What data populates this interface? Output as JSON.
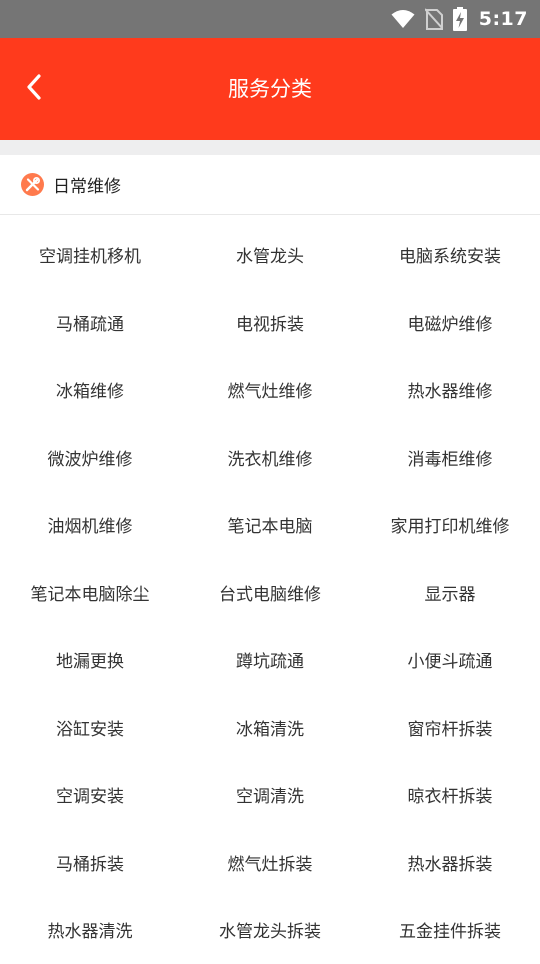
{
  "status_bar": {
    "time": "5:17",
    "icons": [
      "wifi-icon",
      "no-sim-icon",
      "battery-charging-icon"
    ]
  },
  "app_bar": {
    "title": "服务分类",
    "back_icon": "chevron-left-icon",
    "background": "#ff3a1c"
  },
  "section": {
    "title": "日常维修",
    "icon": "repair-tools-icon",
    "icon_color": "#ff7a4d"
  },
  "services": [
    "空调挂机移机",
    "水管龙头",
    "电脑系统安装",
    "马桶疏通",
    "电视拆装",
    "电磁炉维修",
    "冰箱维修",
    "燃气灶维修",
    "热水器维修",
    "微波炉维修",
    "洗衣机维修",
    "消毒柜维修",
    "油烟机维修",
    "笔记本电脑",
    "家用打印机维修",
    "笔记本电脑除尘",
    "台式电脑维修",
    "显示器",
    "地漏更换",
    "蹲坑疏通",
    "小便斗疏通",
    "浴缸安装",
    "冰箱清洗",
    "窗帘杆拆装",
    "空调安装",
    "空调清洗",
    "晾衣杆拆装",
    "马桶拆装",
    "燃气灶拆装",
    "热水器拆装",
    "热水器清洗",
    "水管龙头拆装",
    "五金挂件拆装"
  ]
}
